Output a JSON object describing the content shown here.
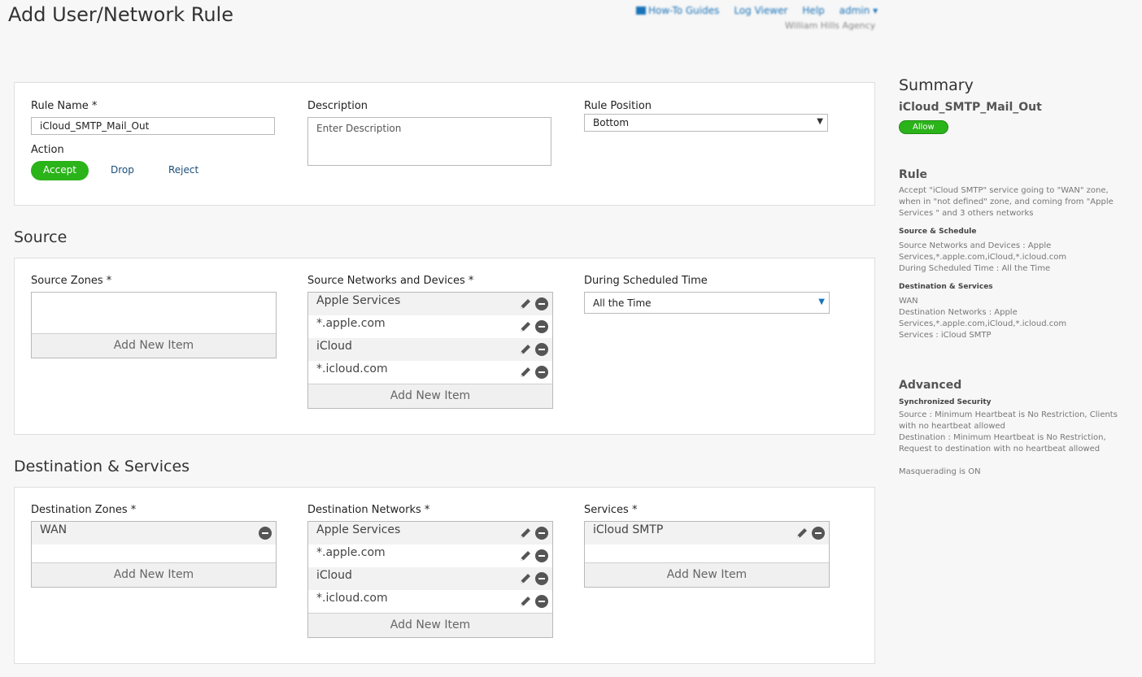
{
  "page": {
    "title": "Add User/Network Rule"
  },
  "topnav": {
    "guides": "How-To Guides",
    "log_viewer": "Log Viewer",
    "help": "Help",
    "user": "admin ▾",
    "org": "William Hills Agency"
  },
  "general": {
    "rule_name_label": "Rule Name *",
    "rule_name_value": "iCloud_SMTP_Mail_Out",
    "description_label": "Description",
    "description_placeholder": "Enter Description",
    "rule_position_label": "Rule Position",
    "rule_position_value": "Bottom",
    "action_label": "Action",
    "action_accept": "Accept",
    "action_drop": "Drop",
    "action_reject": "Reject"
  },
  "source": {
    "title": "Source",
    "zones_label": "Source Zones *",
    "networks_label": "Source Networks and Devices *",
    "networks": [
      "Apple Services",
      "*.apple.com",
      "iCloud",
      "*.icloud.com"
    ],
    "schedule_label": "During Scheduled Time",
    "schedule_value": "All the Time",
    "add_new": "Add New Item"
  },
  "destination": {
    "title": "Destination & Services",
    "zones_label": "Destination Zones *",
    "zones": [
      "WAN"
    ],
    "networks_label": "Destination Networks *",
    "networks": [
      "Apple Services",
      "*.apple.com",
      "iCloud",
      "*.icloud.com"
    ],
    "services_label": "Services *",
    "services": [
      "iCloud SMTP"
    ],
    "add_new": "Add New Item"
  },
  "summary": {
    "title": "Summary",
    "rule_name": "iCloud_SMTP_Mail_Out",
    "badge": "Allow",
    "rule_title": "Rule",
    "rule_text": "Accept \"iCloud SMTP\" service going to \"WAN\" zone, when in \"not defined\" zone, and coming from \"Apple Services \" and 3 others networks",
    "source_schedule_title": "Source & Schedule",
    "source_networks": "Source Networks and Devices : Apple Services,*.apple.com,iCloud,*.icloud.com",
    "scheduled_time": "During Scheduled Time : All the Time",
    "dest_services_title": "Destination & Services",
    "dest_zone": "WAN",
    "dest_networks": "Destination Networks : Apple Services,*.apple.com,iCloud,*.icloud.com",
    "services": "Services : iCloud SMTP",
    "advanced_title": "Advanced",
    "sync_security_title": "Synchronized Security",
    "sync_source": "Source : Minimum Heartbeat is No Restriction, Clients with no heartbeat allowed",
    "sync_destination": "Destination : Minimum Heartbeat is No Restriction, Request to destination with no heartbeat allowed",
    "masquerading": "Masquerading is ON"
  },
  "colors": {
    "accent_green": "#2bb31a",
    "link_blue": "#1a73b8"
  }
}
